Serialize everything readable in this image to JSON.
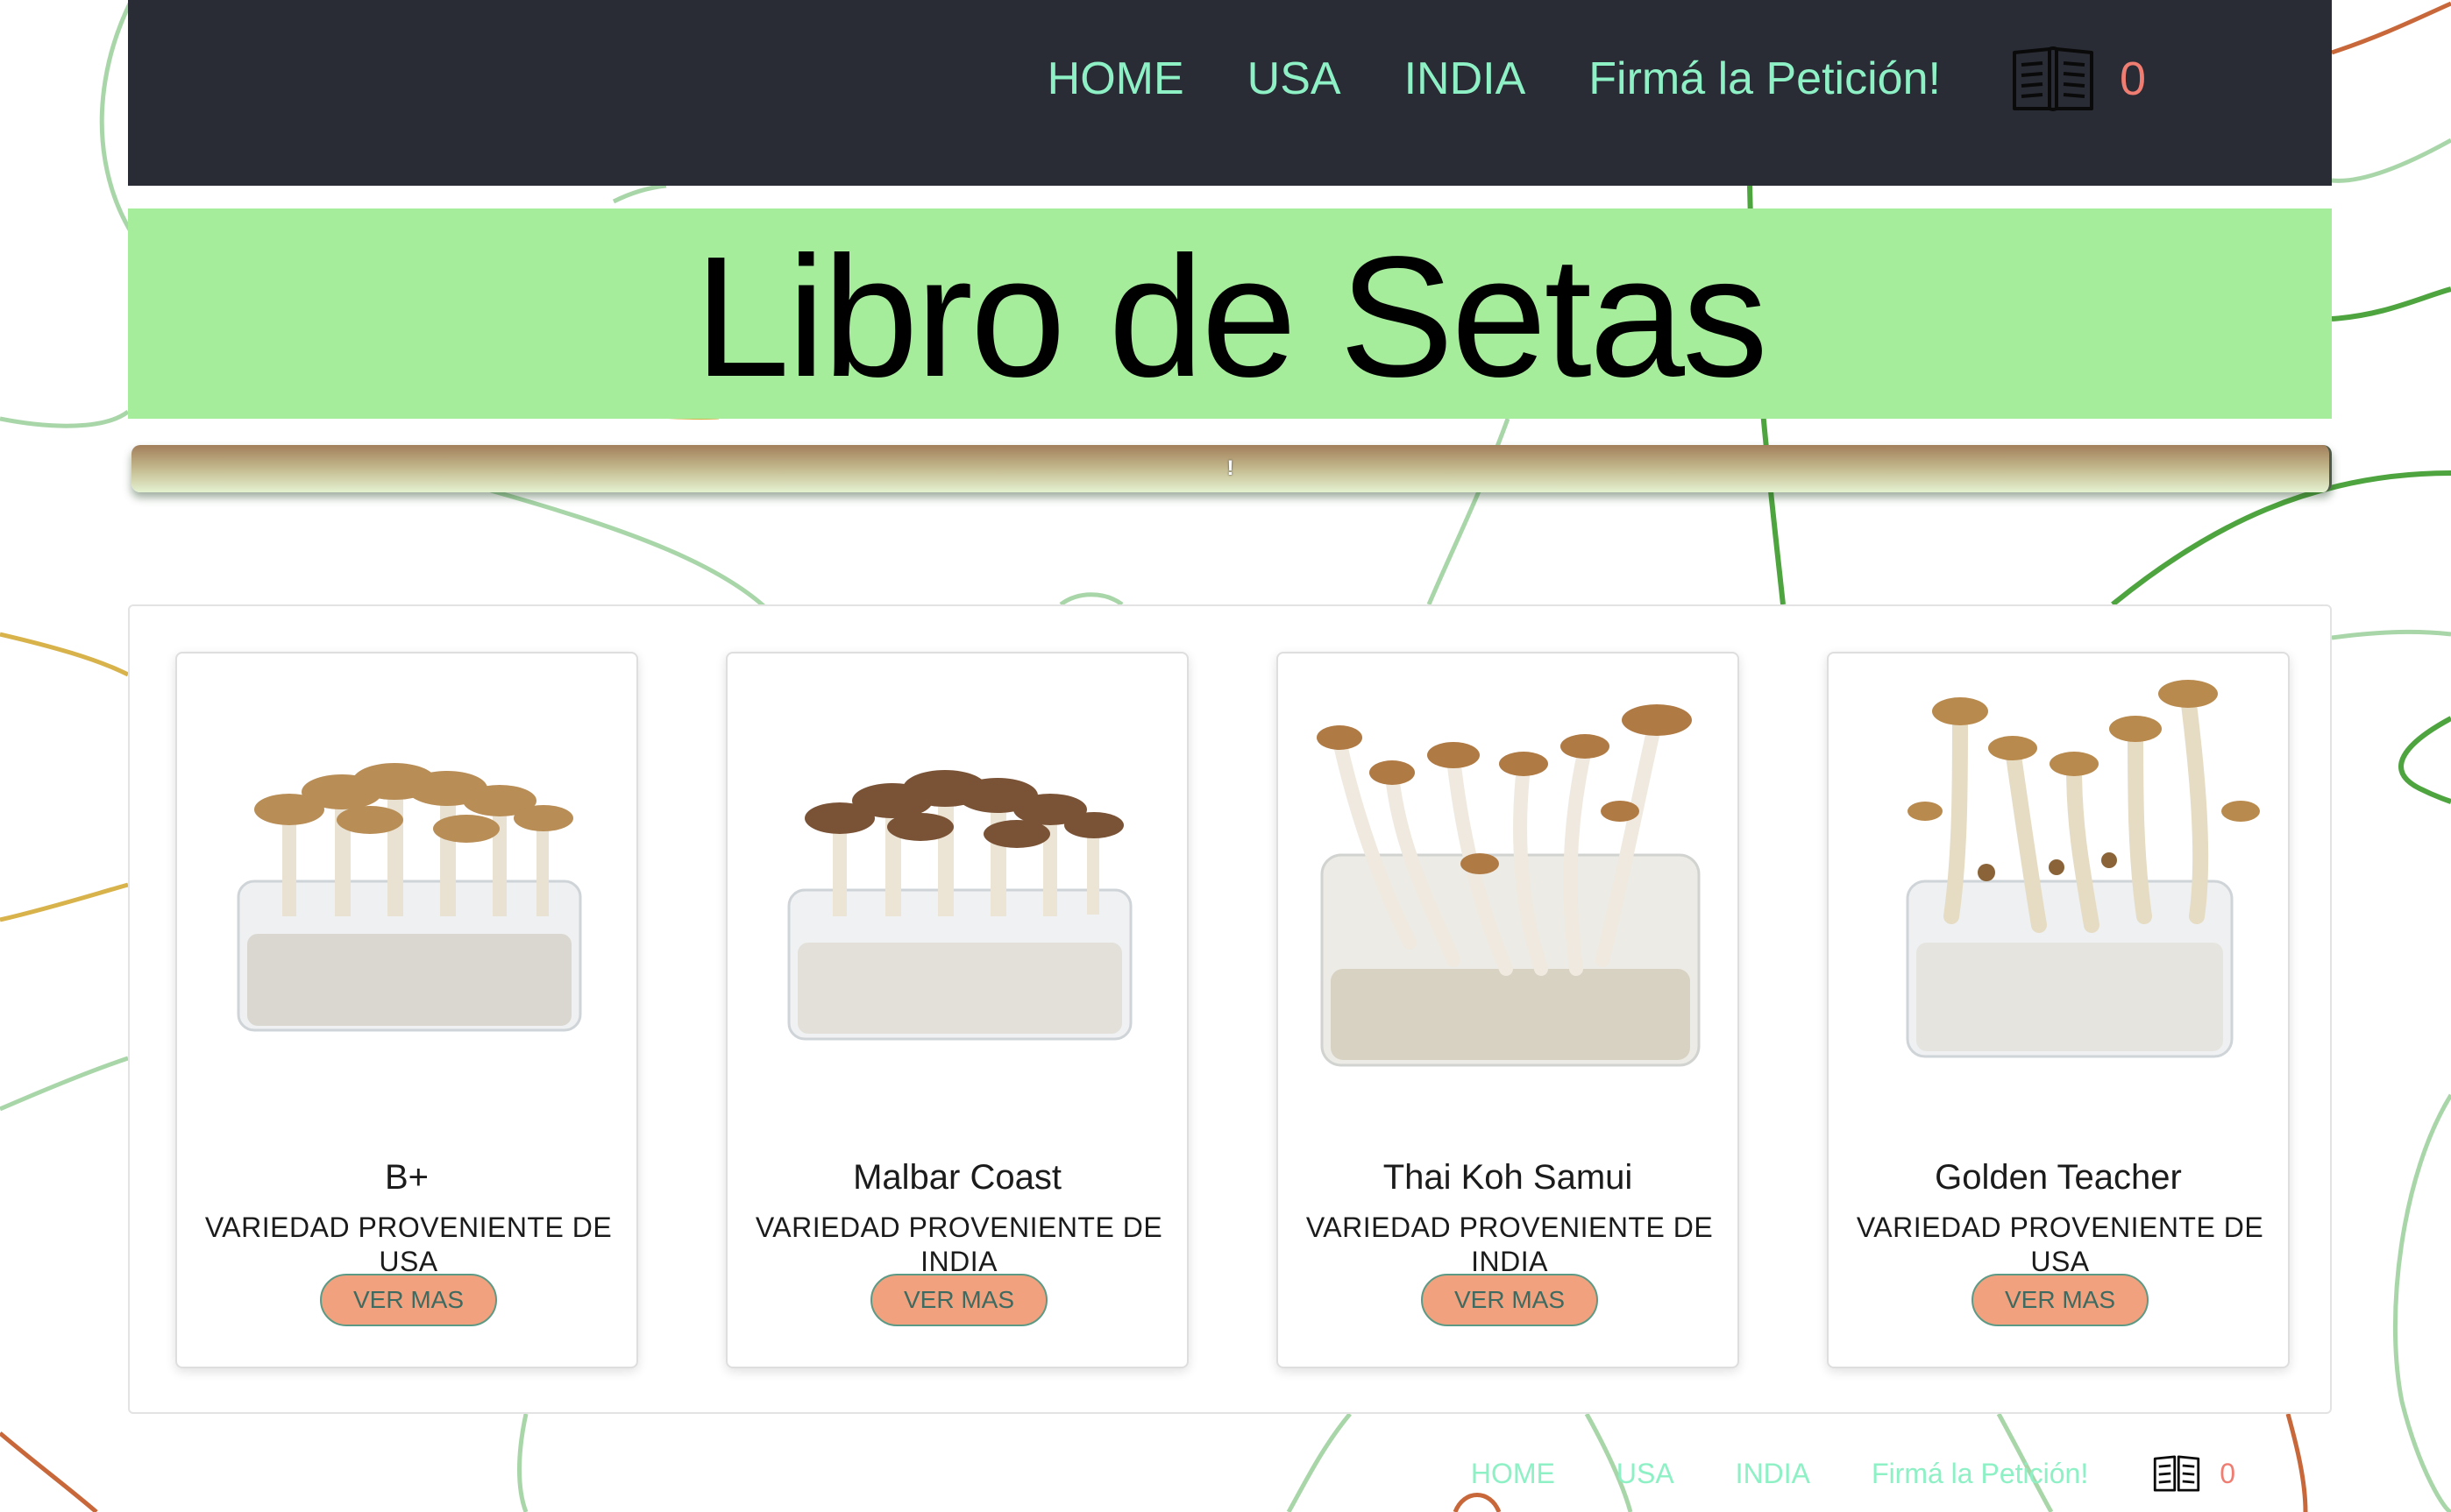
{
  "nav": {
    "links": [
      "HOME",
      "USA",
      "INDIA",
      "Firmá la Petición!"
    ],
    "cart_icon": "book-icon",
    "cart_count": "0"
  },
  "banner": {
    "title": "Libro de Setas"
  },
  "marquee": {
    "text": "!"
  },
  "products": [
    {
      "name": "B+",
      "origin": "VARIEDAD PROVENIENTE DE USA",
      "button": "VER MAS"
    },
    {
      "name": "Malbar Coast",
      "origin": "VARIEDAD PROVENIENTE DE INDIA",
      "button": "VER MAS"
    },
    {
      "name": "Thai Koh Samui",
      "origin": "VARIEDAD PROVENIENTE DE INDIA",
      "button": "VER MAS"
    },
    {
      "name": "Golden Teacher",
      "origin": "VARIEDAD PROVENIENTE DE USA",
      "button": "VER MAS"
    }
  ],
  "footer": {
    "links": [
      "HOME",
      "USA",
      "INDIA",
      "Firmá la Petición!"
    ],
    "cart_count": "0"
  },
  "colors": {
    "nav_bg": "#292c35",
    "nav_link": "#8ef0c5",
    "cart_count": "#f07d72",
    "banner_bg": "#a5ec9b",
    "button_bg": "#f2a17e"
  }
}
